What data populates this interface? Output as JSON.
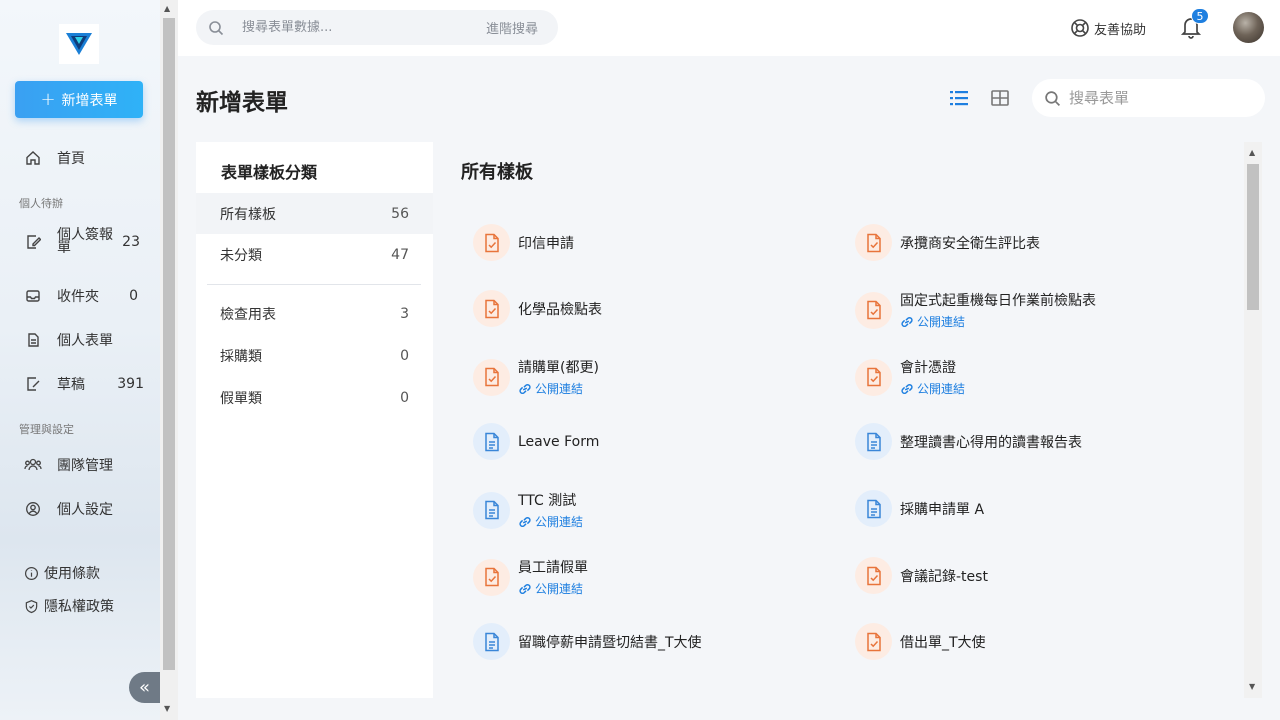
{
  "sidebar": {
    "new_form_label": "新增表單",
    "home": "首頁",
    "section_personal": "個人待辦",
    "sign_forms": "個人簽報單",
    "sign_forms_count": "23",
    "inbox": "收件夾",
    "inbox_count": "0",
    "personal_forms": "個人表單",
    "drafts": "草稿",
    "drafts_count": "391",
    "section_admin": "管理與設定",
    "team": "團隊管理",
    "settings": "個人設定",
    "terms": "使用條款",
    "privacy": "隱私權政策"
  },
  "topbar": {
    "search_placeholder": "搜尋表單數據...",
    "advanced_search": "進階搜尋",
    "help": "友善協助",
    "notification_count": "5"
  },
  "page": {
    "title": "新增表單",
    "template_search_placeholder": "搜尋表單"
  },
  "categories": {
    "title": "表單樣板分類",
    "items": [
      {
        "label": "所有樣板",
        "count": "56"
      },
      {
        "label": "未分類",
        "count": "47"
      },
      {
        "label": "檢查用表",
        "count": "3"
      },
      {
        "label": "採購類",
        "count": "0"
      },
      {
        "label": "假單類",
        "count": "0"
      }
    ]
  },
  "templates": {
    "heading": "所有樣板",
    "public_link": "公開連結",
    "items": [
      {
        "name": "印信申請",
        "color": "orange"
      },
      {
        "name": "承攬商安全衛生評比表",
        "color": "orange"
      },
      {
        "name": "化學品檢點表",
        "color": "orange"
      },
      {
        "name": "固定式起重機每日作業前檢點表",
        "color": "orange",
        "link": true
      },
      {
        "name": "請購單(都更)",
        "color": "orange",
        "link": true
      },
      {
        "name": "會計憑證",
        "color": "orange",
        "link": true
      },
      {
        "name": "Leave Form",
        "color": "blue"
      },
      {
        "name": "整理讀書心得用的讀書報告表",
        "color": "blue"
      },
      {
        "name": "TTC 測試",
        "color": "blue",
        "link": true
      },
      {
        "name": "採購申請單 A",
        "color": "blue"
      },
      {
        "name": "員工請假單",
        "color": "orange",
        "link": true
      },
      {
        "name": "會議記錄-test",
        "color": "orange"
      },
      {
        "name": "留職停薪申請暨切結書_T大使",
        "color": "blue"
      },
      {
        "name": "借出單_T大使",
        "color": "orange"
      }
    ]
  },
  "colors": {
    "accent": "#1e7fe0",
    "orange_icon": "#e8743b",
    "blue_icon": "#3a86d8"
  }
}
